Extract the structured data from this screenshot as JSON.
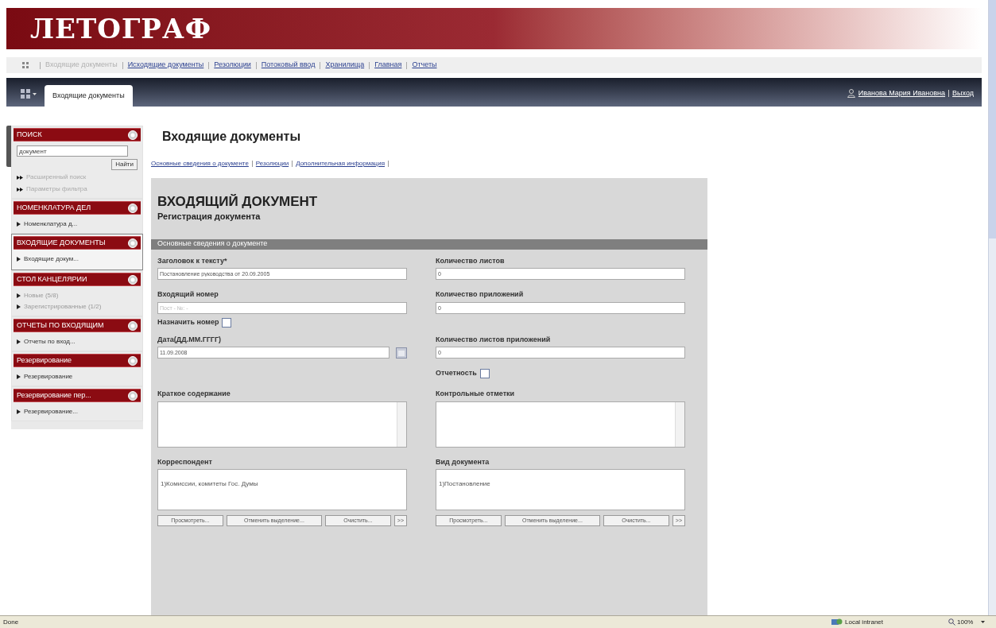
{
  "header": {
    "logo": "ЛЕТОГРАФ"
  },
  "nav": {
    "links": [
      {
        "label": "Входящие документы",
        "selected": true
      },
      {
        "label": "Исходящие документы",
        "selected": false
      },
      {
        "label": "Резолюции",
        "selected": false
      },
      {
        "label": "Потоковый ввод",
        "selected": false
      },
      {
        "label": "Хранилища",
        "selected": false
      },
      {
        "label": "Главная",
        "selected": false
      },
      {
        "label": "Отчеты",
        "selected": false
      }
    ]
  },
  "toolbar": {
    "tab": "Входящие документы",
    "user": "Иванова Мария Ивановна",
    "logout": "Выход"
  },
  "sidebar": {
    "panels": [
      {
        "kind": "search",
        "title": "ПОИСК",
        "selected": false,
        "search_value": "документ",
        "button": "Найти",
        "links": [
          "Расширенный поиск",
          "Параметры фильтра"
        ]
      },
      {
        "kind": "list",
        "title": "НОМЕНКЛАТУРА ДЕЛ",
        "selected": false,
        "items": [
          {
            "label": "Номенклатура д...",
            "disabled": false
          }
        ]
      },
      {
        "kind": "list",
        "title": "ВХОДЯЩИЕ ДОКУМЕНТЫ",
        "selected": true,
        "items": [
          {
            "label": "Входящие докум...",
            "disabled": false
          }
        ]
      },
      {
        "kind": "list",
        "title": "СТОЛ КАНЦЕЛЯРИИ",
        "selected": false,
        "items": [
          {
            "label": "Новые (5/8)",
            "disabled": true
          },
          {
            "label": "Зарегистрированные (1/2)",
            "disabled": true
          }
        ]
      },
      {
        "kind": "list",
        "title": "ОТЧЕТЫ ПО ВХОДЯЩИМ",
        "selected": false,
        "items": [
          {
            "label": "Отчеты по вход...",
            "disabled": false
          }
        ]
      },
      {
        "kind": "list",
        "title": "Резервирование",
        "selected": false,
        "items": [
          {
            "label": "Резервирование",
            "disabled": false
          }
        ]
      },
      {
        "kind": "list",
        "title": "Резервирование пер...",
        "selected": false,
        "items": [
          {
            "label": "Резервирование...",
            "disabled": false
          }
        ]
      }
    ]
  },
  "main": {
    "title": "Входящие документы",
    "subnav": [
      "Основные сведения о документе",
      "Резолюции",
      "Дополнительная информация"
    ],
    "form": {
      "title": "ВХОДЯЩИЙ ДОКУМЕНТ",
      "subtitle": "Регистрация документа",
      "section": "Основные сведения о документе",
      "rows": [
        {
          "left": {
            "kind": "text",
            "label": "Заголовок к тексту*",
            "value": "Постановление руководства от 20.09.2005"
          },
          "right": {
            "kind": "text",
            "label": "Количество листов",
            "value": "0"
          }
        },
        {
          "left": {
            "kind": "text",
            "label": "Входящий номер",
            "placeholder": "Пост - №: -"
          },
          "right": {
            "kind": "text",
            "label": "Количество приложений",
            "value": "0"
          }
        },
        {
          "left": {
            "kind": "checkbox",
            "label": "Назначить номер",
            "checked": false
          }
        },
        {
          "left": {
            "kind": "date",
            "label": "Дата(ДД.ММ.ГГГГ)",
            "value": "11.09.2008"
          },
          "right": {
            "kind": "text",
            "label": "Количество листов приложений",
            "value": "0"
          }
        },
        {
          "right": {
            "kind": "checkbox",
            "label": "Отчетность",
            "checked": false
          }
        },
        {
          "left": {
            "kind": "textarea",
            "label": "Краткое содержание"
          },
          "right": {
            "kind": "textarea",
            "label": "Контрольные отметки"
          }
        },
        {
          "left": {
            "kind": "listbox",
            "label": "Корреспондент",
            "value": "1)Комиссии, комитеты Гос. Думы",
            "buttons": [
              "Просмотреть...",
              "Отменить выделение...",
              "Очистить...",
              ">>"
            ]
          },
          "right": {
            "kind": "listbox",
            "label": "Вид документа",
            "value": "1)Постановление",
            "buttons": [
              "Просмотреть...",
              "Отменить выделение...",
              "Очистить...",
              ">>"
            ]
          }
        }
      ]
    }
  },
  "status_bar": {
    "status": "Done",
    "zone": "Local intranet",
    "zoom": "100%"
  }
}
